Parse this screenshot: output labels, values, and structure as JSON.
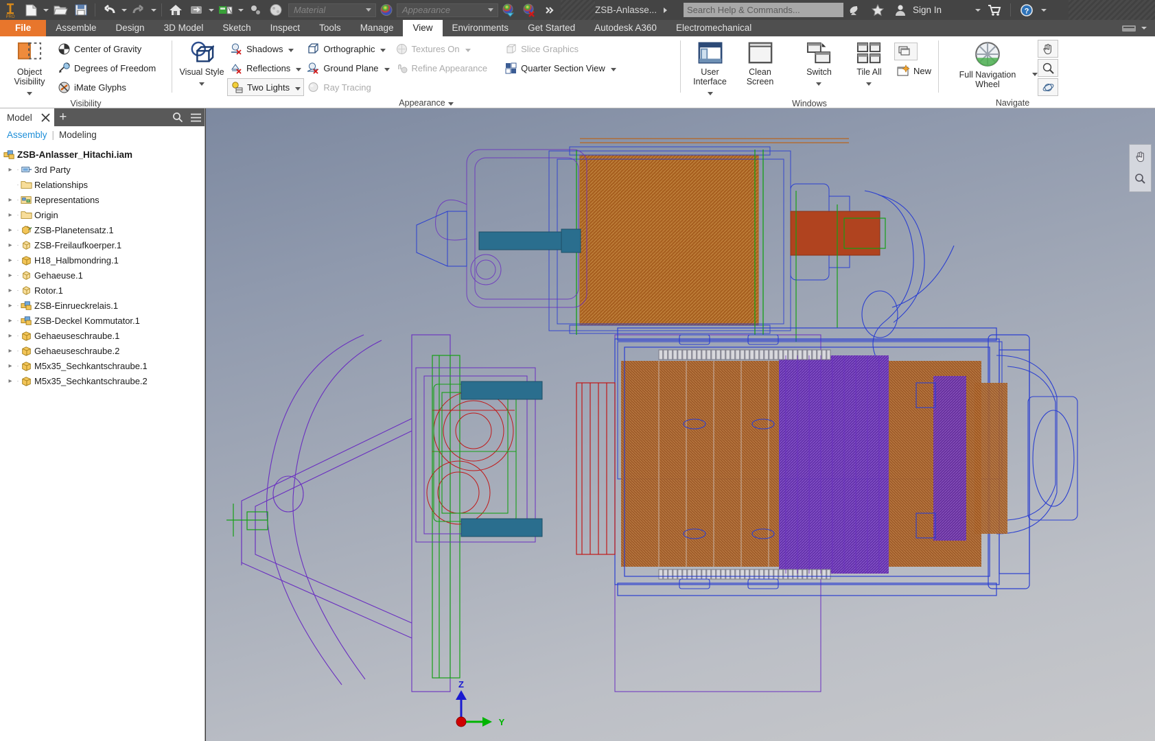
{
  "app": {
    "title": "ZSB-Anlasse...",
    "logo_text": "PRO"
  },
  "quick_access": {
    "items": [
      {
        "name": "new-file",
        "icon": "document-icon",
        "has_dropdown": true
      },
      {
        "name": "open-file",
        "icon": "folder-open-icon",
        "has_dropdown": false
      },
      {
        "name": "save",
        "icon": "floppy-disk-icon",
        "has_dropdown": false
      },
      {
        "name": "undo",
        "icon": "undo-arrow-icon",
        "has_dropdown": true
      },
      {
        "name": "redo",
        "icon": "redo-arrow-icon",
        "has_dropdown": true
      },
      {
        "name": "home",
        "icon": "home-icon",
        "has_dropdown": false
      },
      {
        "name": "return",
        "icon": "return-icon",
        "has_dropdown": true
      },
      {
        "name": "update",
        "icon": "update-icon",
        "has_dropdown": true
      },
      {
        "name": "select",
        "icon": "select-icon",
        "has_dropdown": false
      },
      {
        "name": "material-browser",
        "icon": "sphere-icon",
        "has_dropdown": false
      }
    ],
    "material_placeholder": "Material",
    "appearance_placeholder": "Appearance",
    "appearance_icon": "color-sphere-icon",
    "adjust_icon": "adjust-appearance-icon",
    "clear_icon": "clear-appearance-icon",
    "overflow_icon": "double-chevron-icon"
  },
  "search": {
    "placeholder": "Search Help & Commands..."
  },
  "account": {
    "sign_in": "Sign In",
    "dish_icon": "satellite-dish-icon",
    "star_icon": "star-icon",
    "person_icon": "person-icon",
    "cart_icon": "shopping-cart-icon",
    "help_icon": "help-question-icon"
  },
  "tabs": [
    {
      "label": "File",
      "state": "file"
    },
    {
      "label": "Assemble",
      "state": "normal"
    },
    {
      "label": "Design",
      "state": "normal"
    },
    {
      "label": "3D Model",
      "state": "normal"
    },
    {
      "label": "Sketch",
      "state": "normal"
    },
    {
      "label": "Inspect",
      "state": "normal"
    },
    {
      "label": "Tools",
      "state": "normal"
    },
    {
      "label": "Manage",
      "state": "normal"
    },
    {
      "label": "View",
      "state": "active"
    },
    {
      "label": "Environments",
      "state": "normal"
    },
    {
      "label": "Get Started",
      "state": "normal"
    },
    {
      "label": "Autodesk A360",
      "state": "normal"
    },
    {
      "label": "Electromechanical",
      "state": "normal"
    }
  ],
  "tab_overflow_icon": "keyboard-icon",
  "ribbon": {
    "panels": [
      {
        "title": "Visibility",
        "has_dialog_launcher": false,
        "big_button": {
          "label_line1": "Object",
          "label_line2": "Visibility",
          "icon": "object-visibility-icon",
          "has_dropdown": true
        },
        "small_buttons": [
          {
            "label": "Center of Gravity",
            "icon": "center-of-gravity-icon",
            "disabled": false,
            "dropdown": false
          },
          {
            "label": "Degrees of Freedom",
            "icon": "degrees-of-freedom-icon",
            "disabled": false,
            "dropdown": false
          },
          {
            "label": "iMate Glyphs",
            "icon": "imate-glyphs-icon",
            "disabled": false,
            "dropdown": false
          }
        ]
      },
      {
        "title": "Appearance",
        "has_dialog_launcher": true,
        "big_button": {
          "label_line1": "Visual Style",
          "label_line2": "",
          "icon": "visual-style-icon",
          "has_dropdown": true
        },
        "small_buttons": [
          {
            "label": "Shadows",
            "icon": "shadows-icon",
            "disabled": false,
            "dropdown": true
          },
          {
            "label": "Reflections",
            "icon": "reflections-icon",
            "disabled": false,
            "dropdown": true
          },
          {
            "label": "Two Lights",
            "icon": "lights-icon",
            "disabled": false,
            "dropdown": true,
            "boxed": true
          },
          {
            "label": "Orthographic",
            "icon": "orthographic-icon",
            "disabled": false,
            "dropdown": true
          },
          {
            "label": "Ground Plane",
            "icon": "ground-plane-icon",
            "disabled": false,
            "dropdown": true
          },
          {
            "label": "Ray Tracing",
            "icon": "ray-tracing-icon",
            "disabled": true,
            "dropdown": false
          },
          {
            "label": "Textures On",
            "icon": "textures-icon",
            "disabled": true,
            "dropdown": true
          },
          {
            "label": "Refine Appearance",
            "icon": "refine-appearance-icon",
            "disabled": true,
            "dropdown": false
          },
          {
            "label": "Slice Graphics",
            "icon": "slice-graphics-icon",
            "disabled": true,
            "dropdown": false
          },
          {
            "label": "Quarter Section View",
            "icon": "quarter-section-icon",
            "disabled": false,
            "dropdown": true
          }
        ]
      },
      {
        "title": "Windows",
        "has_dialog_launcher": false,
        "big_buttons": [
          {
            "label_line1": "User",
            "label_line2": "Interface",
            "icon": "user-interface-icon",
            "has_dropdown": true
          },
          {
            "label_line1": "Clean",
            "label_line2": "Screen",
            "icon": "clean-screen-icon",
            "has_dropdown": false
          },
          {
            "label_line1": "Switch",
            "label_line2": "",
            "icon": "switch-windows-icon",
            "has_dropdown": true
          },
          {
            "label_line1": "Tile All",
            "label_line2": "",
            "icon": "tile-all-icon",
            "has_dropdown": true
          }
        ],
        "small_buttons": [
          {
            "label": "",
            "icon": "cascade-icon",
            "disabled": false,
            "dropdown": false,
            "boxed": true
          },
          {
            "label": "New",
            "icon": "new-window-icon",
            "disabled": false,
            "dropdown": false
          }
        ]
      },
      {
        "title": "Navigate",
        "has_dialog_launcher": false,
        "big_button": {
          "label_line1": "Full Navigation",
          "label_line2": "Wheel",
          "icon": "navigation-wheel-icon",
          "has_dropdown": true
        },
        "small_buttons": [
          {
            "label": "",
            "icon": "pan-hand-icon",
            "disabled": false,
            "dropdown": false
          },
          {
            "label": "",
            "icon": "zoom-magnifier-icon",
            "disabled": false,
            "dropdown": false
          },
          {
            "label": "",
            "icon": "orbit-icon",
            "disabled": false,
            "dropdown": false
          }
        ]
      }
    ]
  },
  "browser": {
    "panel_label": "Model",
    "close_icon": "close-icon",
    "add_icon": "plus-icon",
    "search_icon": "search-icon",
    "menu_icon": "hamburger-menu-icon",
    "tab_active": "Assembly",
    "tab_separator": "|",
    "tab_inactive": "Modeling",
    "tree": [
      {
        "label": "ZSB-Anlasser_Hitachi.iam",
        "level": 0,
        "icon": "assembly-icon",
        "expandable": false,
        "bold": true
      },
      {
        "label": "3rd Party",
        "level": 1,
        "icon": "third-party-icon",
        "expandable": true,
        "bold": false
      },
      {
        "label": "Relationships",
        "level": 1,
        "icon": "folder-icon",
        "expandable": false,
        "bold": false
      },
      {
        "label": "Representations",
        "level": 1,
        "icon": "representations-icon",
        "expandable": true,
        "bold": false
      },
      {
        "label": "Origin",
        "level": 1,
        "icon": "folder-icon",
        "expandable": true,
        "bold": false
      },
      {
        "label": "ZSB-Planetensatz.1",
        "level": 1,
        "icon": "subassembly-icon",
        "expandable": true,
        "bold": false
      },
      {
        "label": "ZSB-Freilaufkoerper.1",
        "level": 1,
        "icon": "part-icon",
        "expandable": true,
        "bold": false
      },
      {
        "label": "H18_Halbmondring.1",
        "level": 1,
        "icon": "part-solid-icon",
        "expandable": true,
        "bold": false
      },
      {
        "label": "Gehaeuse.1",
        "level": 1,
        "icon": "part-icon",
        "expandable": true,
        "bold": false
      },
      {
        "label": "Rotor.1",
        "level": 1,
        "icon": "part-icon",
        "expandable": true,
        "bold": false
      },
      {
        "label": "ZSB-Einrueckrelais.1",
        "level": 1,
        "icon": "assembly-icon",
        "expandable": true,
        "bold": false
      },
      {
        "label": "ZSB-Deckel Kommutator.1",
        "level": 1,
        "icon": "assembly-icon",
        "expandable": true,
        "bold": false
      },
      {
        "label": "Gehaeuseschraube.1",
        "level": 1,
        "icon": "part-solid-icon",
        "expandable": true,
        "bold": false
      },
      {
        "label": "Gehaeuseschraube.2",
        "level": 1,
        "icon": "part-solid-icon",
        "expandable": true,
        "bold": false
      },
      {
        "label": "M5x35_Sechkantschraube.1",
        "level": 1,
        "icon": "part-solid-icon",
        "expandable": true,
        "bold": false
      },
      {
        "label": "M5x35_Sechkantschraube.2",
        "level": 1,
        "icon": "part-solid-icon",
        "expandable": true,
        "bold": false
      }
    ]
  },
  "viewport": {
    "model_name": "Hitachi starter motor assembly (wireframe visual style)",
    "axis_triad": {
      "z_label": "Z",
      "y_label": "Y",
      "z_color": "#1a1ad0",
      "y_color": "#00b400",
      "origin_color": "#d00000"
    },
    "nav_bar_icons": [
      "pan-hand-icon",
      "zoom-magnifier-icon"
    ],
    "colors": {
      "bg_top": "#7d89a0",
      "bg_bottom": "#c7c8cb",
      "wire_blue": "#2b3fd0",
      "wire_purple": "#6a2fc0",
      "wire_orange": "#b8641e",
      "wire_green": "#15a015",
      "wire_red": "#c01818",
      "wire_teal": "#2a6e8e"
    }
  }
}
